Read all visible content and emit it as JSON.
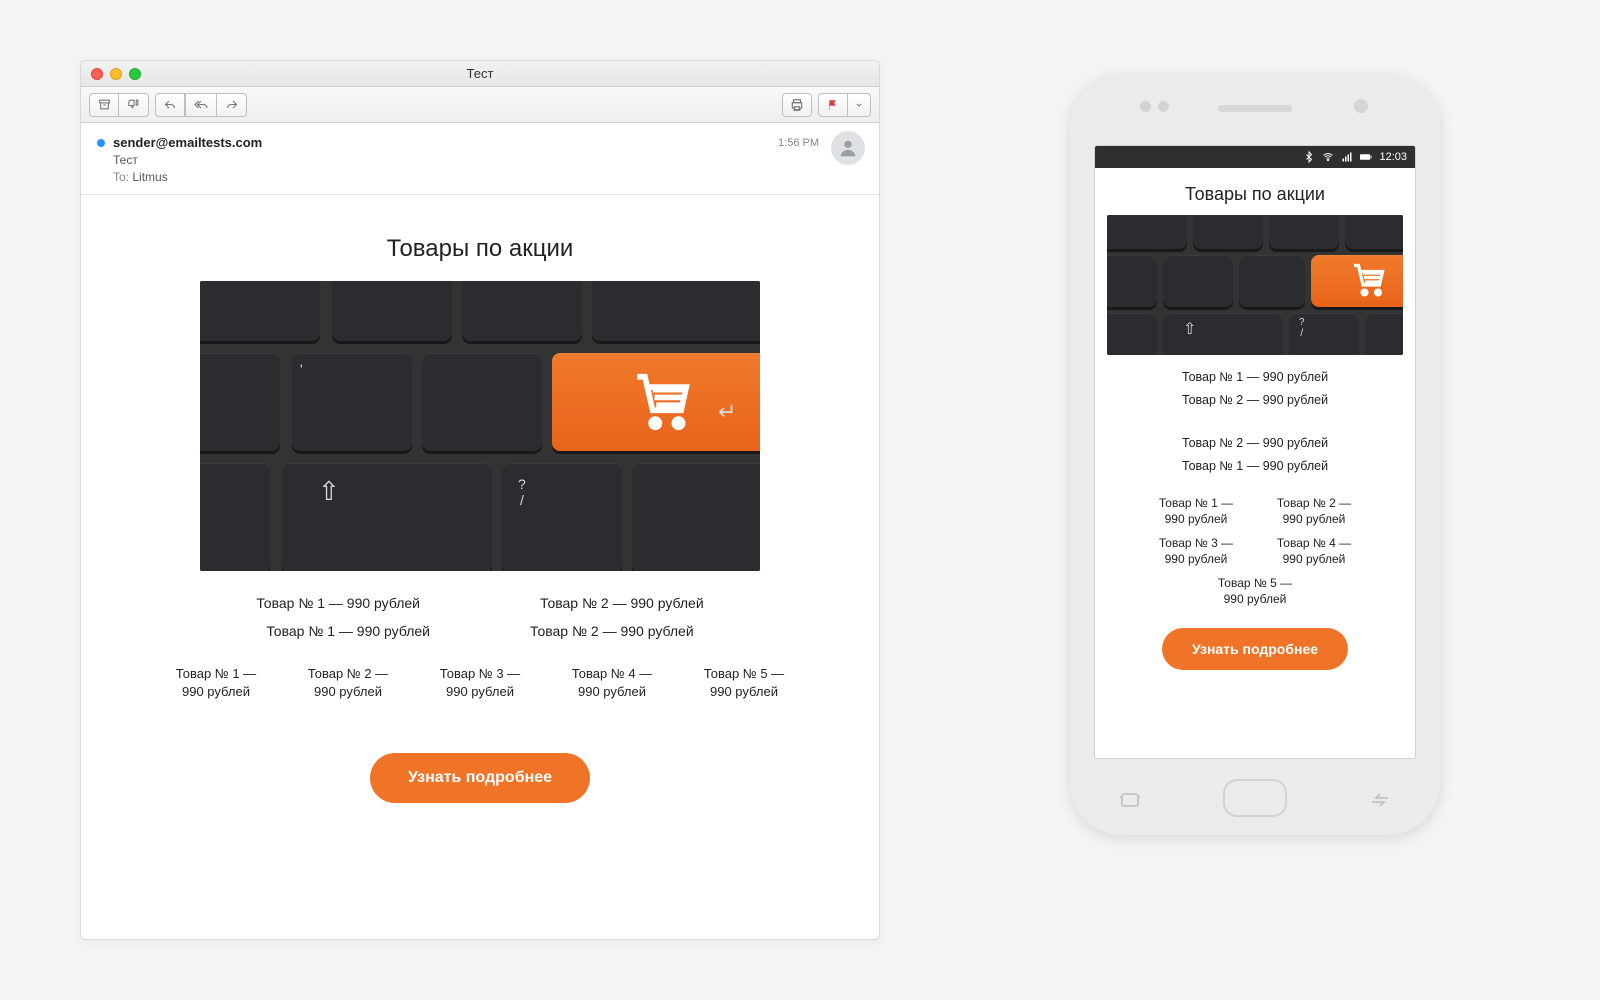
{
  "desktop": {
    "window_title": "Тест",
    "sender": "sender@emailtests.com",
    "subject": "Тест",
    "to_label": "To:",
    "to_value": "Litmus",
    "time": "1:56 PM",
    "email_heading": "Товары по акции",
    "row1": {
      "left": "Товар № 1 — 990 рублей",
      "right": "Товар № 2 — 990 рублей"
    },
    "row2": {
      "left": "Товар № 1 — 990 рублей",
      "right": "Товар № 2 — 990 рублей"
    },
    "row3": [
      {
        "t": "Товар № 1 —",
        "b": "990 рублей"
      },
      {
        "t": "Товар № 2 —",
        "b": "990 рублей"
      },
      {
        "t": "Товар № 3 —",
        "b": "990 рублей"
      },
      {
        "t": "Товар № 4 —",
        "b": "990 рублей"
      },
      {
        "t": "Товар № 5 —",
        "b": "990 рублей"
      }
    ],
    "cta": "Узнать подробнее"
  },
  "mobile": {
    "status_time": "12:03",
    "email_heading": "Товары по акции",
    "list_a": [
      "Товар № 1 — 990 рублей",
      "Товар № 2 — 990 рублей"
    ],
    "list_b": [
      "Товар № 2 — 990 рублей",
      "Товар № 1 — 990 рублей"
    ],
    "grid": [
      {
        "t": "Товар № 1 —",
        "b": "990 рублей"
      },
      {
        "t": "Товар № 2 —",
        "b": "990 рублей"
      },
      {
        "t": "Товар № 3 —",
        "b": "990 рублей"
      },
      {
        "t": "Товар № 4 —",
        "b": "990 рублей"
      },
      {
        "t": "Товар № 5 —",
        "b": "990 рублей"
      }
    ],
    "cta": "Узнать подробнее"
  },
  "colors": {
    "accent": "#f07427"
  }
}
